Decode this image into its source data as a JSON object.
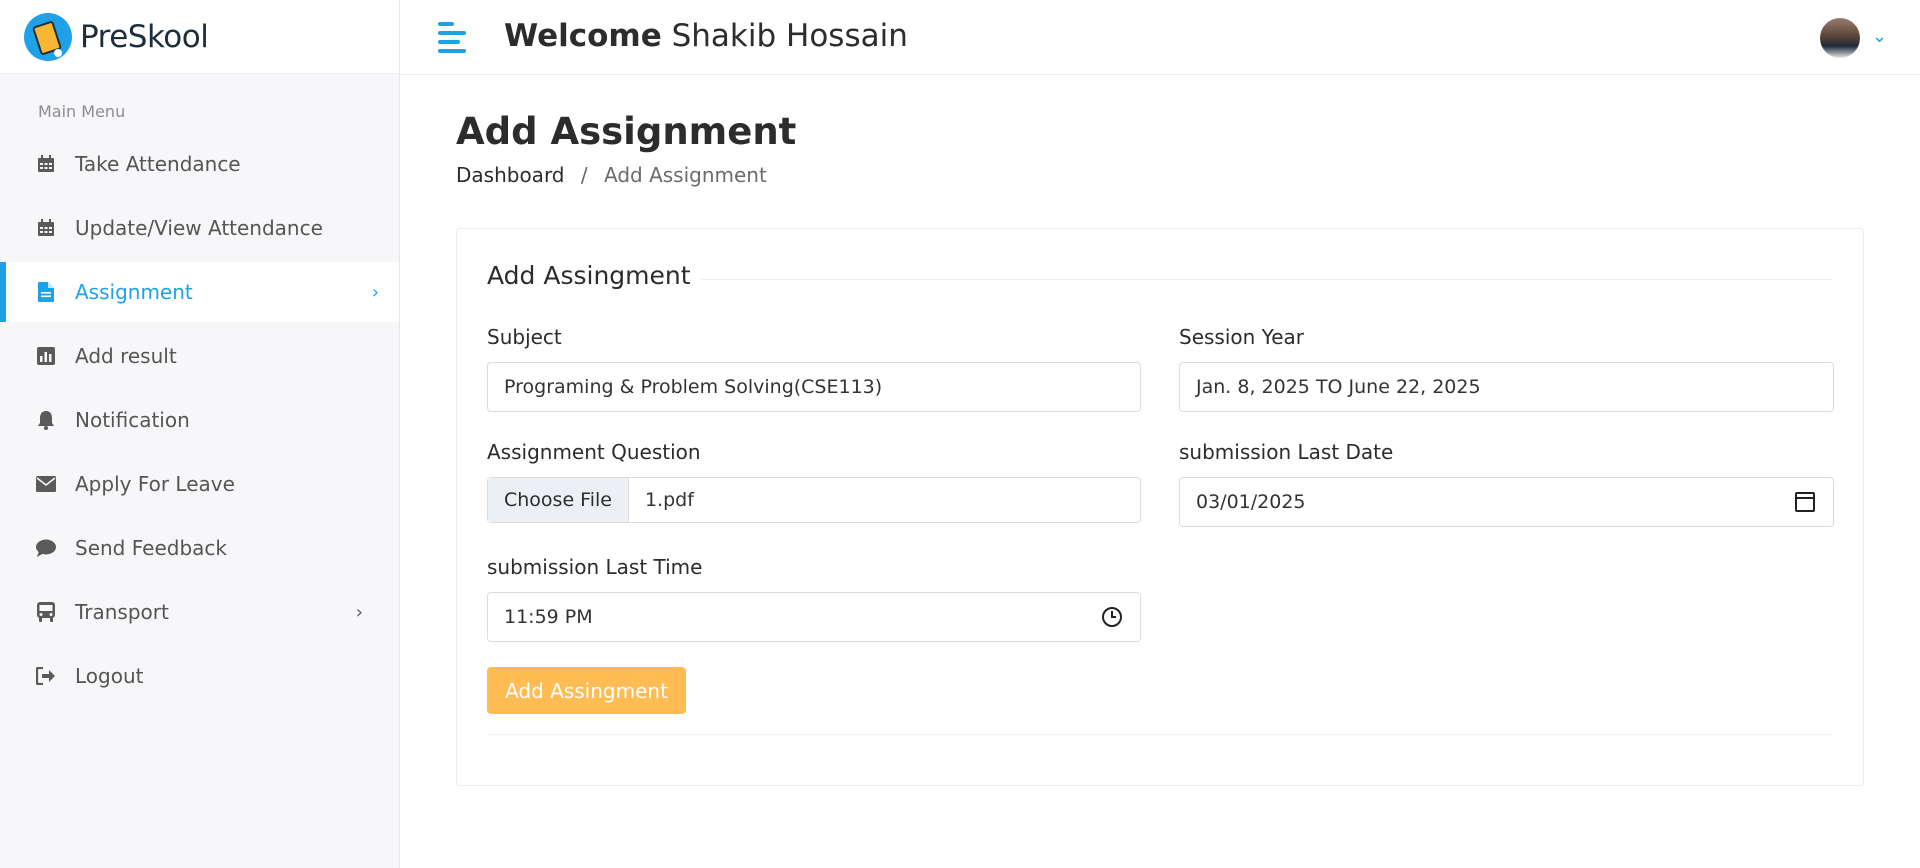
{
  "brand": {
    "name": "PreSkool"
  },
  "sidebar": {
    "menu_title": "Main Menu",
    "items": [
      {
        "label": "Take Attendance",
        "icon": "calendar-icon",
        "active": false
      },
      {
        "label": "Update/View Attendance",
        "icon": "calendar-icon",
        "active": false
      },
      {
        "label": "Assignment",
        "icon": "file-icon",
        "active": true,
        "chevron": "›"
      },
      {
        "label": "Add result",
        "icon": "bar-chart-icon",
        "active": false
      },
      {
        "label": "Notification",
        "icon": "bell-icon",
        "active": false
      },
      {
        "label": "Apply For Leave",
        "icon": "envelope-icon",
        "active": false
      },
      {
        "label": "Send Feedback",
        "icon": "comment-icon",
        "active": false
      },
      {
        "label": "Transport",
        "icon": "bus-icon",
        "active": false,
        "chevron": "›"
      },
      {
        "label": "Logout",
        "icon": "sign-out-icon",
        "active": false
      }
    ]
  },
  "header": {
    "welcome_word": "Welcome",
    "user_name": "Shakib Hossain",
    "dropdown_chevron": "⌄"
  },
  "page": {
    "title": "Add Assignment",
    "breadcrumb": {
      "link": "Dashboard",
      "separator": "/",
      "current": "Add Assignment"
    }
  },
  "form": {
    "title": "Add Assingment",
    "subject": {
      "label": "Subject",
      "value": "Programing & Problem Solving(CSE113)"
    },
    "session_year": {
      "label": "Session Year",
      "value": "Jan. 8, 2025 TO June 22, 2025"
    },
    "assignment_question": {
      "label": "Assignment Question",
      "button_label": "Choose File",
      "file_name": "1.pdf"
    },
    "submission_last_date": {
      "label": "submission Last Date",
      "value": "03/01/2025"
    },
    "submission_last_time": {
      "label": "submission Last Time",
      "value": "11:59 PM"
    },
    "submit_label": "Add Assingment"
  },
  "colors": {
    "accent": "#1fa1e8",
    "button": "#ffbc53",
    "sidebar_bg": "#f7f7fa"
  }
}
